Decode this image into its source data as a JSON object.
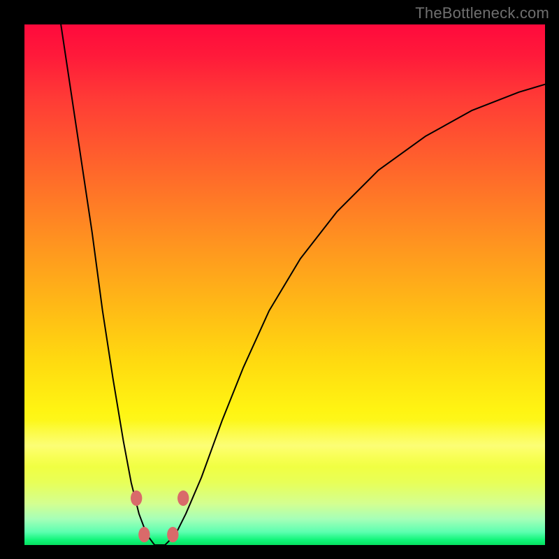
{
  "watermark": {
    "text": "TheBottleneck.com"
  },
  "chart_data": {
    "type": "line",
    "title": "",
    "xlabel": "",
    "ylabel": "",
    "xlim": [
      0,
      100
    ],
    "ylim": [
      0,
      100
    ],
    "grid": false,
    "series": [
      {
        "name": "bottleneck-curve",
        "x": [
          7,
          10,
          13,
          15,
          17,
          19,
          20.5,
          22,
          23.5,
          25,
          27,
          29,
          31,
          34,
          38,
          42,
          47,
          53,
          60,
          68,
          77,
          86,
          95,
          100
        ],
        "values": [
          100,
          80,
          60,
          45,
          32,
          20,
          12,
          6,
          2,
          0,
          0,
          2,
          6,
          13,
          24,
          34,
          45,
          55,
          64,
          72,
          78.5,
          83.5,
          87,
          88.5
        ]
      }
    ],
    "markers": [
      {
        "name": "left-shoulder-upper",
        "x": 21.5,
        "y": 9
      },
      {
        "name": "left-shoulder-lower",
        "x": 23.0,
        "y": 2
      },
      {
        "name": "right-shoulder-lower",
        "x": 28.5,
        "y": 2
      },
      {
        "name": "right-shoulder-upper",
        "x": 30.5,
        "y": 9
      }
    ],
    "marker_style": {
      "color": "#d96a6a",
      "radius_pct": 1.1
    },
    "curve_style": {
      "color": "#000000",
      "stroke_px": 2
    },
    "background_gradient_stops": [
      {
        "pos": 0,
        "color": "#ff0a3c"
      },
      {
        "pos": 50,
        "color": "#ffb916"
      },
      {
        "pos": 80,
        "color": "#fff412"
      },
      {
        "pos": 100,
        "color": "#06e060"
      }
    ]
  }
}
